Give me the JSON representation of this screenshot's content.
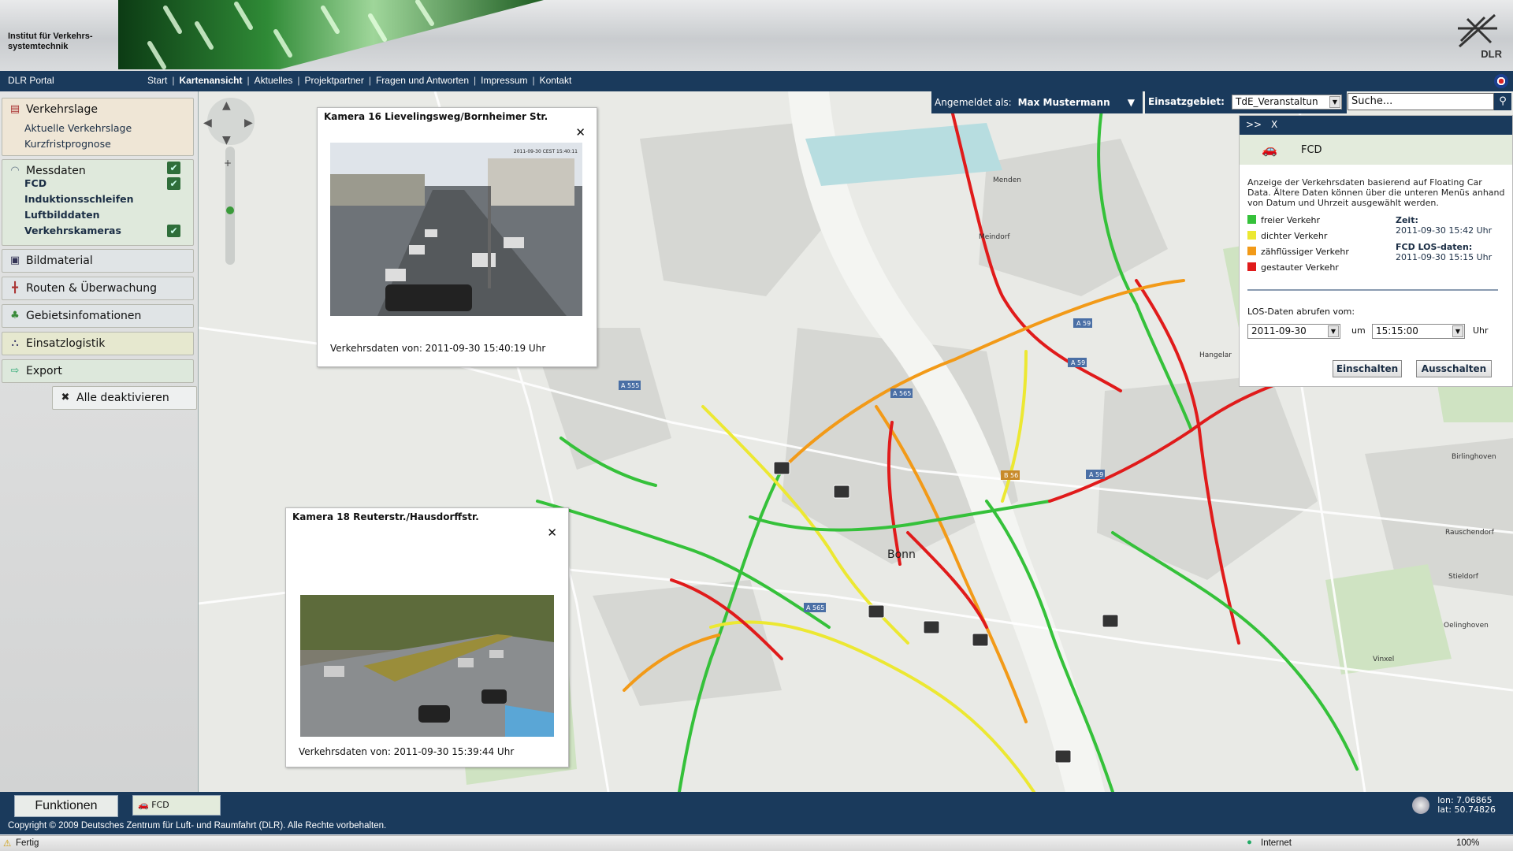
{
  "header": {
    "institute_line1": "Institut für Verkehrs-",
    "institute_line2": "systemtechnik",
    "logo_text": "DLR"
  },
  "nav": {
    "portal": "DLR Portal",
    "links": [
      "Start",
      "Kartenansicht",
      "Aktuelles",
      "Projektpartner",
      "Fragen und Antworten",
      "Impressum",
      "Kontakt"
    ],
    "active": "Kartenansicht"
  },
  "sidebar": {
    "verkehrslage": {
      "title": "Verkehrslage",
      "items": [
        "Aktuelle Verkehrslage",
        "Kurzfristprognose"
      ]
    },
    "messdaten": {
      "title": "Messdaten",
      "items": [
        "FCD",
        "Induktionsschleifen",
        "Luftbilddaten",
        "Verkehrskameras"
      ]
    },
    "sections": [
      "Bildmaterial",
      "Routen & Überwachung",
      "Gebietsinfomationen",
      "Einsatzlogistik",
      "Export"
    ],
    "deactivate": "Alle deaktivieren"
  },
  "topbar": {
    "login_label": "Angemeldet als:",
    "user": "Max Mustermann",
    "area_label": "Einsatzgebiet:",
    "area_value": "TdE_Veranstaltun",
    "search_placeholder": "Suche..."
  },
  "camera1": {
    "title": "Kamera 16 Lievelingsweg/Bornheimer Str.",
    "caption": "Verkehrsdaten von: 2011-09-30 15:40:19 Uhr",
    "stamp": "2011-09-30 CEST 15:40:11"
  },
  "camera2": {
    "title": "Kamera 18 Reuterstr./Hausdorffstr.",
    "caption": "Verkehrsdaten von: 2011-09-30 15:39:44 Uhr"
  },
  "fcd": {
    "toggle": ">>",
    "close": "X",
    "title": "FCD",
    "description": "Anzeige der Verkehrsdaten basierend auf Floating Car Data. Ältere Daten können über die unteren Menüs anhand von Datum und Uhrzeit ausgewählt werden.",
    "legend": [
      {
        "label": "freier Verkehr",
        "color": "#35c13a"
      },
      {
        "label": "dichter Verkehr",
        "color": "#ece832"
      },
      {
        "label": "zähflüssiger Verkehr",
        "color": "#f29a18"
      },
      {
        "label": "gestauter Verkehr",
        "color": "#e01b1b"
      }
    ],
    "zeit_label": "Zeit:",
    "zeit_value": "2011-09-30 15:42 Uhr",
    "los_label": "FCD LOS-daten:",
    "los_value": "2011-09-30 15:15 Uhr",
    "fetch_label": "LOS-Daten abrufen vom:",
    "date_value": "2011-09-30",
    "um": "um",
    "time_value": "15:15:00",
    "uhr": "Uhr",
    "btn_on": "Einschalten",
    "btn_off": "Ausschalten"
  },
  "map": {
    "city": "Bonn",
    "places": [
      "Menden",
      "Meindorf",
      "Hangelar",
      "Birlinghoven",
      "Rauschendorf",
      "Stieldorf",
      "Oelinghoven",
      "Vinxel"
    ],
    "roads": [
      "A 59",
      "A 59",
      "A 565",
      "A 555",
      "A 565",
      "B 56",
      "A 59"
    ]
  },
  "footer": {
    "funktionen": "Funktionen",
    "tab": "FCD",
    "lon": "lon: 7.06865",
    "lat": "lat: 50.74826",
    "copyright": "Copyright © 2009 Deutsches Zentrum für Luft- und Raumfahrt (DLR). Alle Rechte vorbehalten."
  },
  "statusbar": {
    "left": "Fertig",
    "zone": "Internet",
    "zoom": "100%"
  },
  "colors": {
    "navy": "#1a3a5c",
    "free": "#35c13a",
    "dense": "#ece832",
    "slow": "#f29a18",
    "jam": "#e01b1b"
  }
}
